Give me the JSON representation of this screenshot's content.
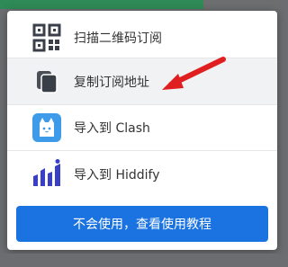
{
  "menu": {
    "items": [
      {
        "label": "扫描二维码订阅",
        "icon": "qr-code-icon"
      },
      {
        "label": "复制订阅地址",
        "icon": "copy-icon"
      },
      {
        "label": "导入到 Clash",
        "icon": "clash-cat-icon"
      },
      {
        "label": "导入到 Hiddify",
        "icon": "hiddify-icon"
      }
    ],
    "help_button_label": "不会使用，查看使用教程"
  },
  "colors": {
    "accent": "#1a73e0",
    "arrow": "#e02020",
    "hover_row": "#f1f2f4",
    "clash_icon": "#3d9be9",
    "hiddify_icon": "#3a3fc7"
  }
}
